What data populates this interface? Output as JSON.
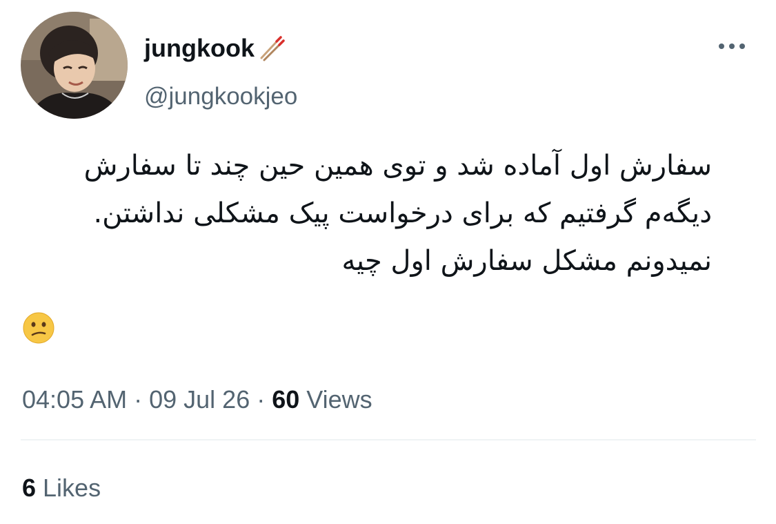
{
  "author": {
    "display_name": "jungkook",
    "badge_icon": "chopsticks-icon",
    "handle": "@jungkookjeo"
  },
  "tweet": {
    "lines": [
      "سفارش اول آماده شد و توی همین حین چند تا سفارش",
      "دیگه‌م گرفتیم که برای درخواست پیک مشکلی نداشتن.",
      "نمیدونم مشکل سفارش اول چیه"
    ],
    "emoji": "confused-face-emoji"
  },
  "meta": {
    "time": "04:05 AM",
    "separator": "·",
    "date": "09 Jul 26",
    "views_count": "60",
    "views_label": "Views"
  },
  "engagement": {
    "likes_count": "6",
    "likes_label": "Likes"
  },
  "colors": {
    "primary_text": "#0f1419",
    "secondary_text": "#536471",
    "divider": "#eff3f4",
    "emoji_yellow": "#f7c745"
  }
}
